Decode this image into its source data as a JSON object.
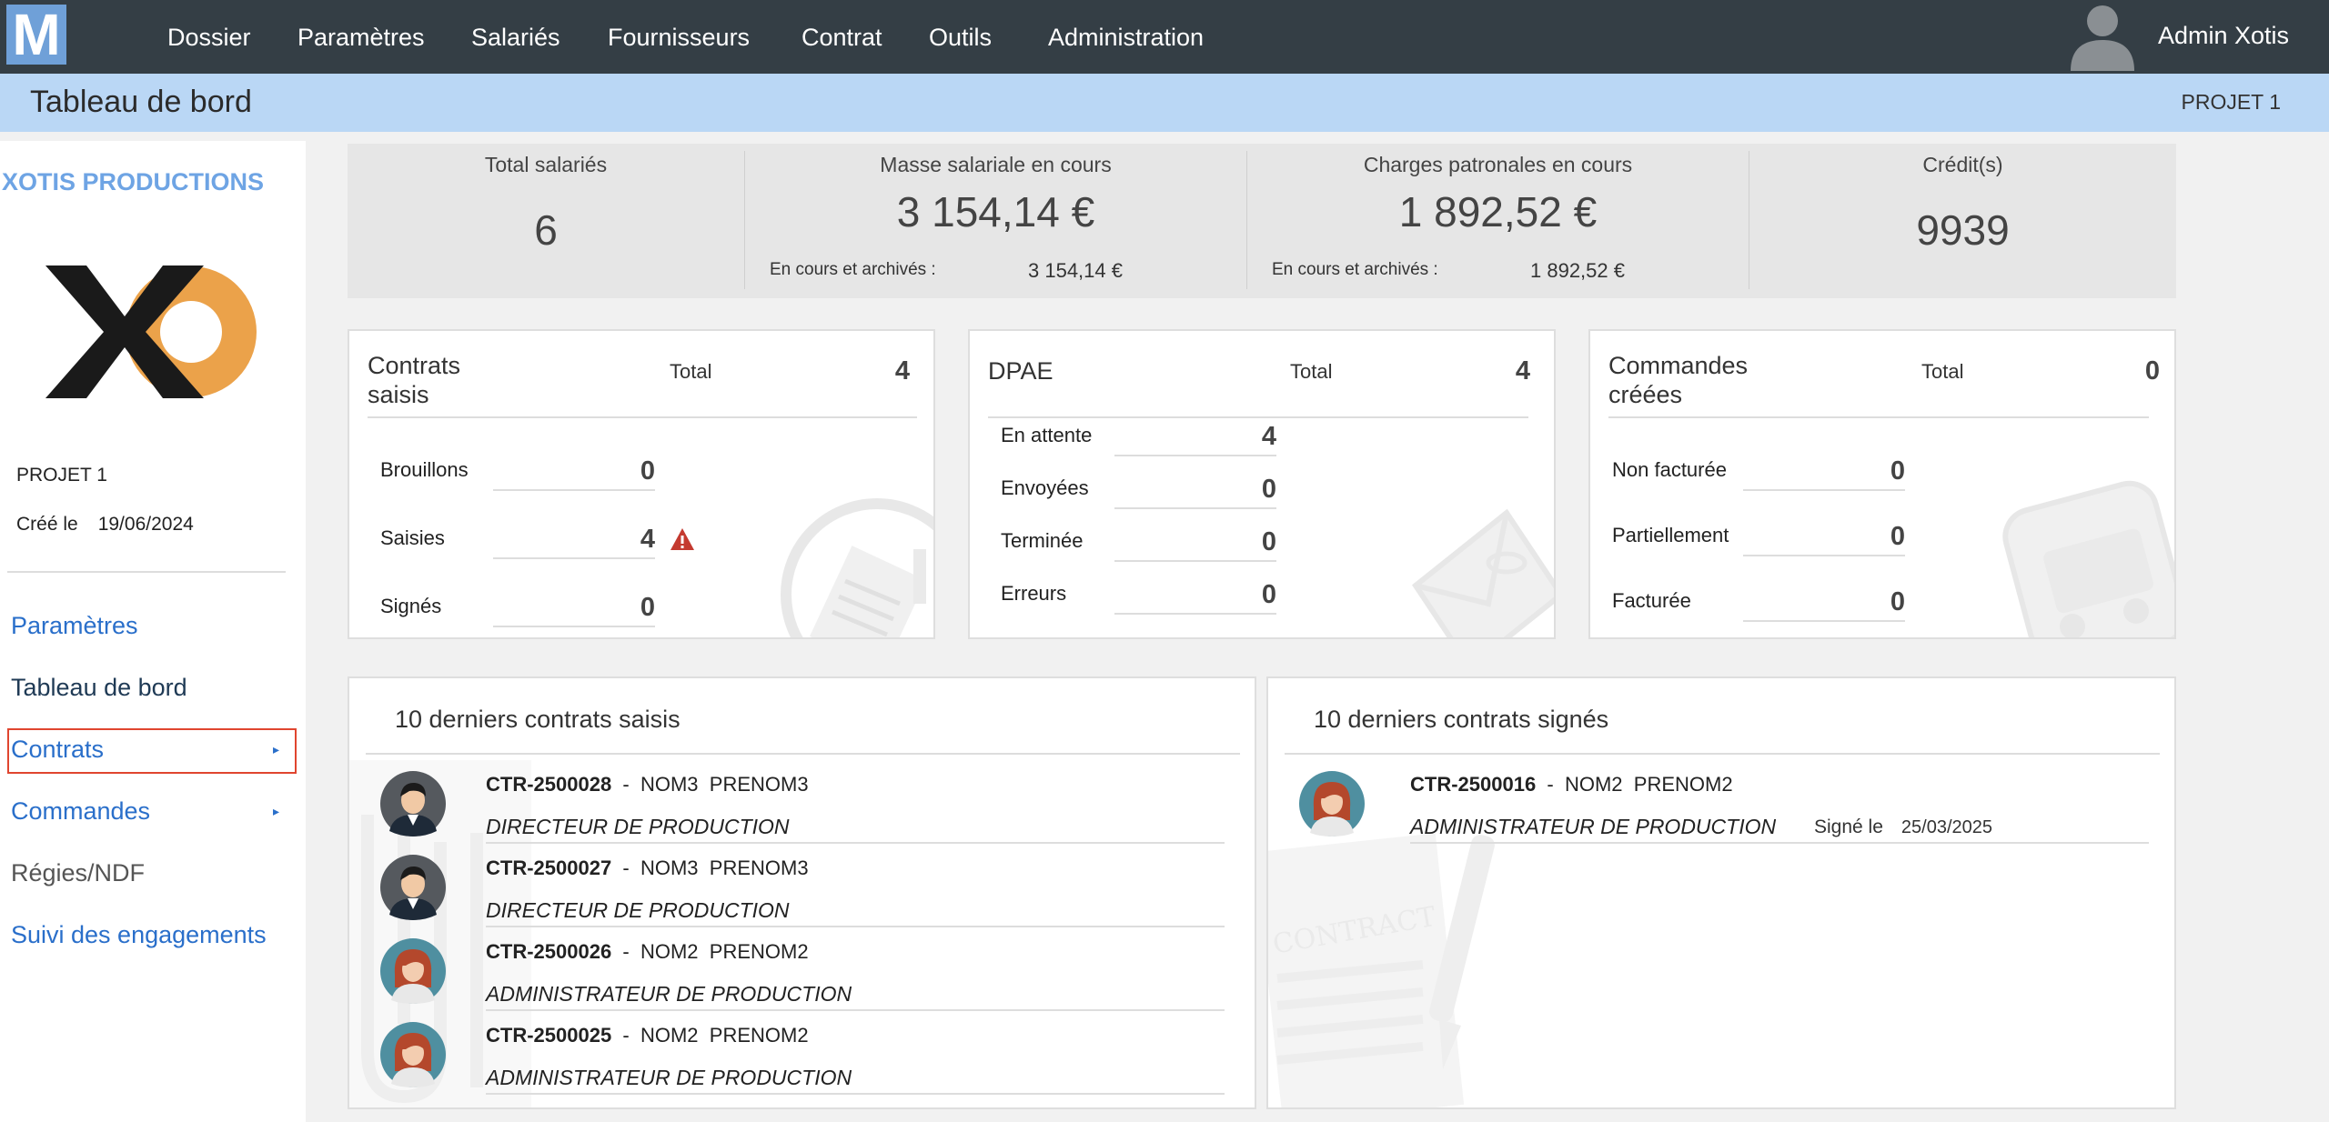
{
  "app": {
    "logo_letter": "M"
  },
  "nav": {
    "items": [
      {
        "label": "Dossier"
      },
      {
        "label": "Paramètres"
      },
      {
        "label": "Salariés"
      },
      {
        "label": "Fournisseurs"
      },
      {
        "label": "Contrat"
      },
      {
        "label": "Outils"
      },
      {
        "label": "Administration"
      }
    ],
    "user_name": "Admin Xotis"
  },
  "titlebar": {
    "title": "Tableau de bord",
    "project": "PROJET 1"
  },
  "sidebar": {
    "company": "XOTIS PRODUCTIONS",
    "project": "PROJET 1",
    "created_label": "Créé le",
    "created_date": "19/06/2024",
    "links": [
      {
        "label": "Paramètres"
      },
      {
        "label": "Tableau de bord"
      },
      {
        "label": "Contrats"
      },
      {
        "label": "Commandes"
      },
      {
        "label": "Régies/NDF"
      },
      {
        "label": "Suivi des engagements"
      }
    ]
  },
  "kpi": {
    "total_salaries": {
      "label": "Total salariés",
      "value": "6"
    },
    "masse": {
      "label": "Masse salariale en cours",
      "value": "3 154,14 €",
      "sub_label": "En cours et archivés :",
      "sub_value": "3 154,14 €"
    },
    "charges": {
      "label": "Charges patronales en cours",
      "value": "1 892,52 €",
      "sub_label": "En cours et archivés :",
      "sub_value": "1 892,52 €"
    },
    "credits": {
      "label": "Crédit(s)",
      "value": "9939"
    }
  },
  "cards": {
    "contrats": {
      "title_line1": "Contrats",
      "title_line2": "saisis",
      "total_label": "Total",
      "total": "4",
      "rows": [
        {
          "label": "Brouillons",
          "value": "0"
        },
        {
          "label": "Saisies",
          "value": "4"
        },
        {
          "label": "Signés",
          "value": "0"
        }
      ]
    },
    "dpae": {
      "title": "DPAE",
      "total_label": "Total",
      "total": "4",
      "rows": [
        {
          "label": "En attente",
          "value": "4"
        },
        {
          "label": "Envoyées",
          "value": "0"
        },
        {
          "label": "Terminée",
          "value": "0"
        },
        {
          "label": "Erreurs",
          "value": "0"
        }
      ]
    },
    "commandes": {
      "title_line1": "Commandes",
      "title_line2": "créées",
      "total_label": "Total",
      "total": "0",
      "rows": [
        {
          "label": "Non facturée",
          "value": "0"
        },
        {
          "label": "Partiellement",
          "value": "0"
        },
        {
          "label": "Facturée",
          "value": "0"
        }
      ]
    }
  },
  "lists": {
    "saisis": {
      "title": "10 derniers contrats saisis",
      "rows": [
        {
          "ref": "CTR-2500028",
          "dash": "-",
          "nom": "NOM3",
          "prenom": "PRENOM3",
          "role": "DIRECTEUR DE PRODUCTION",
          "avatar": "male"
        },
        {
          "ref": "CTR-2500027",
          "dash": "-",
          "nom": "NOM3",
          "prenom": "PRENOM3",
          "role": "DIRECTEUR DE PRODUCTION",
          "avatar": "male"
        },
        {
          "ref": "CTR-2500026",
          "dash": "-",
          "nom": "NOM2",
          "prenom": "PRENOM2",
          "role": "ADMINISTRATEUR DE PRODUCTION",
          "avatar": "female"
        },
        {
          "ref": "CTR-2500025",
          "dash": "-",
          "nom": "NOM2",
          "prenom": "PRENOM2",
          "role": "ADMINISTRATEUR DE PRODUCTION",
          "avatar": "female"
        }
      ]
    },
    "signes": {
      "title": "10 derniers contrats signés",
      "watermark_text": "CONTRACT",
      "rows": [
        {
          "ref": "CTR-2500016",
          "dash": "-",
          "nom": "NOM2",
          "prenom": "PRENOM2",
          "role": "ADMINISTRATEUR DE PRODUCTION",
          "signed_label": "Signé le",
          "signed_date": "25/03/2025",
          "avatar": "female"
        }
      ]
    }
  },
  "colors": {
    "topbar": "#343e45",
    "titlebar": "#bad7f5",
    "link": "#2a6fca",
    "accent": "#6ea4e4",
    "highlight": "#e0452f",
    "xo_orange": "#eba24a"
  }
}
